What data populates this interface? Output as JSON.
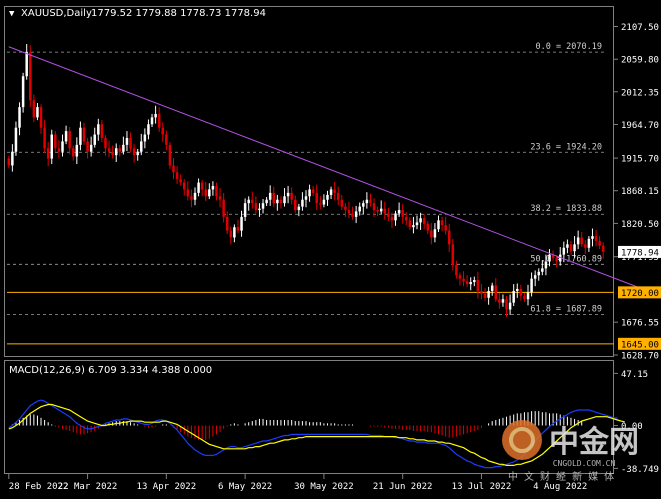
{
  "header": {
    "symbol_period": "XAUUSD,Daily",
    "ohlc": "1779.52 1779.88 1778.73 1778.94"
  },
  "colors": {
    "background": "#000000",
    "bull_candle": "#ffffff",
    "bear_candle": "#e00000",
    "trendline": "#b050e0",
    "hline": "#ffb000",
    "fib": "#a0a0a0",
    "macd_signal": "#ffff00",
    "macd_main": "#1a3cff",
    "price_label_bg": "#ffffff",
    "hline_label_bg": "#ffb000"
  },
  "chart_data": [
    {
      "type": "candlestick",
      "title": "XAUUSD,Daily",
      "ylim": [
        1620,
        2130
      ],
      "y_ticks": [
        "2107.50",
        "2059.80",
        "2012.35",
        "1964.70",
        "1915.70",
        "1868.15",
        "1820.50",
        "1771.95",
        "1676.55",
        "1628.70"
      ],
      "x_ticks": [
        "28 Feb 2022",
        "22 Mar 2022",
        "13 Apr 2022",
        "6 May 2022",
        "30 May 2022",
        "21 Jun 2022",
        "13 Jul 2022",
        "4 Aug 2022"
      ],
      "last_price_label": "1778.94",
      "fibonacci_levels": [
        {
          "label": "0.0 = 2070.19",
          "value": 2070.19
        },
        {
          "label": "23.6 = 1924.20",
          "value": 1924.2
        },
        {
          "label": "38.2 = 1833.88",
          "value": 1833.88
        },
        {
          "label": "50.0 = 1760.89",
          "value": 1760.89
        },
        {
          "label": "61.8 = 1687.89",
          "value": 1687.89
        }
      ],
      "horizontal_lines": [
        {
          "label": "1720.00",
          "value": 1720.0
        },
        {
          "label": "1645.00",
          "value": 1645.0
        }
      ],
      "trendline": {
        "start": [
          0,
          2078
        ],
        "end": [
          176,
          1727
        ]
      },
      "close": [
        1905,
        1925,
        1960,
        1990,
        2035,
        2070,
        2000,
        1975,
        1990,
        1960,
        1930,
        1915,
        1950,
        1930,
        1925,
        1940,
        1955,
        1930,
        1918,
        1935,
        1960,
        1940,
        1925,
        1935,
        1950,
        1965,
        1945,
        1930,
        1925,
        1920,
        1930,
        1925,
        1935,
        1945,
        1930,
        1920,
        1925,
        1940,
        1950,
        1965,
        1975,
        1980,
        1960,
        1950,
        1935,
        1905,
        1895,
        1885,
        1880,
        1870,
        1860,
        1855,
        1865,
        1880,
        1870,
        1860,
        1870,
        1875,
        1860,
        1855,
        1830,
        1810,
        1800,
        1815,
        1810,
        1830,
        1850,
        1855,
        1850,
        1840,
        1842,
        1850,
        1855,
        1865,
        1850,
        1855,
        1850,
        1860,
        1865,
        1855,
        1840,
        1845,
        1855,
        1860,
        1870,
        1865,
        1850,
        1848,
        1855,
        1862,
        1870,
        1865,
        1855,
        1845,
        1840,
        1835,
        1830,
        1838,
        1845,
        1850,
        1855,
        1850,
        1840,
        1838,
        1842,
        1835,
        1830,
        1825,
        1835,
        1840,
        1830,
        1825,
        1815,
        1818,
        1822,
        1828,
        1820,
        1810,
        1800,
        1812,
        1825,
        1818,
        1810,
        1790,
        1760,
        1745,
        1740,
        1736,
        1732,
        1735,
        1738,
        1722,
        1718,
        1712,
        1722,
        1730,
        1710,
        1705,
        1710,
        1695,
        1705,
        1722,
        1725,
        1715,
        1710,
        1720,
        1740,
        1745,
        1750,
        1755,
        1765,
        1775,
        1770,
        1765,
        1775,
        1785,
        1790,
        1780,
        1790,
        1800,
        1790,
        1785,
        1798,
        1802,
        1795,
        1788,
        1779
      ],
      "open": [
        1915,
        1905,
        1925,
        1960,
        1990,
        2035,
        2070,
        2000,
        1975,
        1990,
        1960,
        1930,
        1915,
        1950,
        1930,
        1925,
        1940,
        1955,
        1930,
        1918,
        1935,
        1960,
        1940,
        1925,
        1935,
        1950,
        1965,
        1945,
        1930,
        1925,
        1920,
        1930,
        1925,
        1935,
        1945,
        1930,
        1920,
        1925,
        1940,
        1950,
        1965,
        1975,
        1980,
        1960,
        1950,
        1935,
        1905,
        1895,
        1885,
        1880,
        1870,
        1860,
        1855,
        1865,
        1880,
        1870,
        1860,
        1870,
        1875,
        1860,
        1855,
        1830,
        1810,
        1800,
        1815,
        1810,
        1830,
        1850,
        1855,
        1850,
        1840,
        1842,
        1850,
        1855,
        1865,
        1850,
        1855,
        1850,
        1860,
        1865,
        1855,
        1840,
        1845,
        1855,
        1860,
        1870,
        1865,
        1850,
        1848,
        1855,
        1862,
        1870,
        1865,
        1855,
        1845,
        1840,
        1835,
        1830,
        1838,
        1845,
        1850,
        1855,
        1850,
        1840,
        1838,
        1842,
        1835,
        1830,
        1825,
        1835,
        1840,
        1830,
        1825,
        1815,
        1818,
        1822,
        1828,
        1820,
        1810,
        1800,
        1812,
        1825,
        1818,
        1810,
        1790,
        1760,
        1745,
        1740,
        1736,
        1732,
        1735,
        1738,
        1722,
        1718,
        1712,
        1722,
        1730,
        1710,
        1705,
        1710,
        1695,
        1705,
        1722,
        1725,
        1715,
        1710,
        1720,
        1740,
        1745,
        1750,
        1755,
        1765,
        1775,
        1770,
        1765,
        1775,
        1785,
        1790,
        1780,
        1790,
        1800,
        1790,
        1785,
        1798,
        1802,
        1795,
        1788
      ]
    },
    {
      "type": "macd",
      "title": "MACD(12,26,9) 6.709 3.334 4.388 0.000",
      "ylim": [
        -42,
        52
      ],
      "y_ticks": [
        "47.15",
        "0.00",
        "-38.749"
      ],
      "main": [
        -2,
        0,
        3,
        6,
        10,
        14,
        18,
        20,
        22,
        23,
        22,
        20,
        18,
        16,
        14,
        12,
        10,
        8,
        5,
        2,
        0,
        -2,
        -3,
        -3,
        -2,
        -1,
        0,
        2,
        3,
        4,
        5,
        5,
        6,
        6,
        5,
        4,
        3,
        2,
        1,
        1,
        2,
        4,
        5,
        5,
        4,
        2,
        -1,
        -4,
        -8,
        -12,
        -16,
        -19,
        -22,
        -24,
        -26,
        -27,
        -27,
        -27,
        -26,
        -24,
        -22,
        -20,
        -19,
        -19,
        -20,
        -20,
        -19,
        -18,
        -17,
        -16,
        -15,
        -14,
        -14,
        -13,
        -12,
        -11,
        -10,
        -9,
        -9,
        -8,
        -8,
        -8,
        -8,
        -8,
        -8,
        -8,
        -8,
        -8,
        -8,
        -8,
        -8,
        -8,
        -8,
        -8,
        -8,
        -8,
        -8,
        -8,
        -8,
        -8,
        -8,
        -9,
        -9,
        -9,
        -9,
        -10,
        -10,
        -10,
        -11,
        -11,
        -12,
        -13,
        -14,
        -14,
        -15,
        -15,
        -15,
        -16,
        -16,
        -16,
        -16,
        -17,
        -18,
        -20,
        -23,
        -26,
        -28,
        -30,
        -32,
        -33,
        -35,
        -36,
        -37,
        -38,
        -38,
        -38,
        -37,
        -37,
        -36,
        -35,
        -34,
        -33,
        -31,
        -29,
        -26,
        -22,
        -18,
        -14,
        -10,
        -7,
        -4,
        -1,
        2,
        4,
        6,
        8,
        10,
        12,
        13,
        14,
        14,
        14,
        14,
        13,
        12,
        11,
        10,
        9,
        8,
        7,
        6.709
      ],
      "signal": [
        -3,
        -2,
        0,
        2,
        5,
        8,
        11,
        13,
        15,
        17,
        18,
        19,
        19,
        18,
        17,
        16,
        15,
        14,
        12,
        10,
        8,
        6,
        4,
        3,
        2,
        1,
        0,
        0,
        1,
        1,
        2,
        2,
        3,
        3,
        4,
        4,
        4,
        4,
        3,
        3,
        3,
        3,
        3,
        4,
        4,
        3,
        2,
        1,
        -1,
        -3,
        -5,
        -7,
        -9,
        -11,
        -13,
        -15,
        -17,
        -18,
        -19,
        -20,
        -21,
        -21,
        -21,
        -21,
        -21,
        -21,
        -21,
        -20,
        -20,
        -19,
        -19,
        -18,
        -17,
        -16,
        -16,
        -15,
        -14,
        -13,
        -13,
        -12,
        -12,
        -11,
        -11,
        -10,
        -10,
        -10,
        -10,
        -10,
        -10,
        -10,
        -10,
        -10,
        -10,
        -10,
        -10,
        -10,
        -10,
        -10,
        -10,
        -10,
        -10,
        -10,
        -10,
        -10,
        -10,
        -10,
        -10,
        -10,
        -10,
        -11,
        -11,
        -11,
        -12,
        -12,
        -13,
        -13,
        -13,
        -14,
        -14,
        -14,
        -15,
        -15,
        -16,
        -16,
        -17,
        -18,
        -19,
        -20,
        -22,
        -24,
        -25,
        -27,
        -29,
        -30,
        -32,
        -33,
        -34,
        -35,
        -35,
        -36,
        -36,
        -36,
        -35,
        -35,
        -34,
        -33,
        -32,
        -30,
        -28,
        -26,
        -23,
        -20,
        -17,
        -14,
        -11,
        -8,
        -5,
        -2,
        0,
        2,
        4,
        5,
        6,
        7,
        8,
        8,
        8,
        8,
        7,
        6,
        5,
        4,
        3.334
      ],
      "histogram": [
        0,
        1,
        3,
        5,
        7,
        9,
        10,
        10,
        9,
        7,
        5,
        3,
        1,
        -1,
        -2,
        -3,
        -4,
        -5,
        -6,
        -7,
        -8,
        -8,
        -7,
        -6,
        -5,
        -3,
        -1,
        1,
        2,
        3,
        4,
        4,
        4,
        4,
        3,
        2,
        1,
        0,
        -1,
        -2,
        -2,
        -1,
        0,
        1,
        1,
        0,
        -2,
        -4,
        -6,
        -8,
        -10,
        -11,
        -12,
        -13,
        -13,
        -13,
        -12,
        -10,
        -8,
        -6,
        -3,
        -1,
        1,
        2,
        1,
        0,
        2,
        3,
        4,
        5,
        6,
        6,
        5,
        5,
        5,
        5,
        5,
        5,
        5,
        5,
        4,
        4,
        4,
        4,
        3,
        3,
        3,
        3,
        2,
        2,
        2,
        2,
        1,
        1,
        1,
        1,
        1,
        0,
        0,
        0,
        0,
        -1,
        -1,
        -1,
        -1,
        -2,
        -2,
        -3,
        -3,
        -3,
        -4,
        -4,
        -4,
        -5,
        -5,
        -5,
        -5,
        -6,
        -6,
        -7,
        -8,
        -9,
        -10,
        -11,
        -11,
        -10,
        -9,
        -8,
        -7,
        -6,
        -5,
        -4,
        -2,
        0,
        2,
        4,
        5,
        6,
        7,
        8,
        9,
        10,
        11,
        11,
        12,
        12,
        13,
        13,
        13,
        12,
        12,
        11,
        11,
        11,
        10,
        9,
        8,
        7,
        6,
        5,
        4.388
      ]
    }
  ],
  "watermark": {
    "logo_text": "中金网",
    "domain": "CNGOLD.COM.CN",
    "slogan": "中 文 财 经 新 媒 体"
  }
}
